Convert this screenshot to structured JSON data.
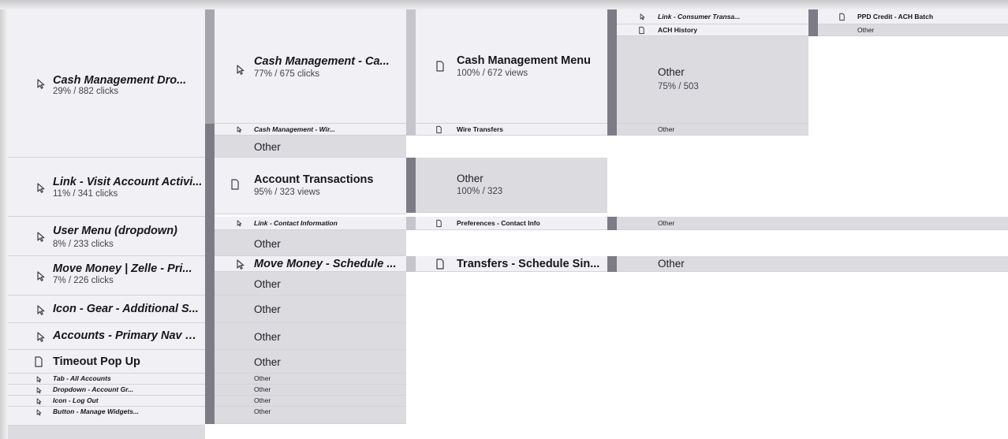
{
  "flow": {
    "level1": [
      {
        "title": "Cash Management Dro...",
        "stat": "29% / 882 clicks",
        "icon": "cursor-icon"
      },
      {
        "title": "Link - Visit Account Activi...",
        "stat": "11% / 341 clicks",
        "icon": "cursor-icon"
      },
      {
        "title": "User Menu (dropdown)",
        "stat": "8% / 233 clicks",
        "icon": "cursor-icon"
      },
      {
        "title": "Move Money | Zelle - Pri...",
        "stat": "7% / 226 clicks",
        "icon": "cursor-icon"
      },
      {
        "title": "Icon - Gear - Additional S...",
        "icon": "cursor-icon"
      },
      {
        "title": "Accounts - Primary Nav D...",
        "icon": "cursor-icon"
      },
      {
        "title": "Timeout Pop Up",
        "icon": "page-icon"
      },
      {
        "title": "Tab - All Accounts",
        "icon": "cursor-icon"
      },
      {
        "title": "Dropdown - Account Gr...",
        "icon": "cursor-icon"
      },
      {
        "title": "Icon - Log Out",
        "icon": "cursor-icon"
      },
      {
        "title": "Button - Manage Widgets...",
        "icon": "cursor-icon"
      }
    ],
    "level2": [
      {
        "title": "Cash Management - Ca...",
        "stat": "77% / 675 clicks",
        "icon": "cursor-icon"
      },
      {
        "title": "Cash Management - Wir...",
        "icon": "cursor-icon"
      },
      {
        "title": "Account Transactions",
        "stat": "95% / 323 views",
        "icon": "page-icon"
      },
      {
        "title": "Link - Contact Information",
        "icon": "cursor-icon"
      },
      {
        "title": "Move Money - Schedule ...",
        "icon": "cursor-icon"
      }
    ],
    "level3": [
      {
        "title": "Cash Management Menu",
        "stat": "100% / 672 views",
        "icon": "page-icon"
      },
      {
        "title": "Wire Transfers",
        "icon": "page-icon"
      },
      {
        "title": "Other",
        "stat": "100% / 323"
      },
      {
        "title": "Preferences - Contact Info",
        "icon": "page-icon"
      },
      {
        "title": "Transfers - Schedule Sin...",
        "icon": "page-icon"
      }
    ],
    "level4": [
      {
        "title": "Link - Consumer Transa...",
        "icon": "cursor-icon"
      },
      {
        "title": "ACH History",
        "icon": "page-icon"
      },
      {
        "title": "Other",
        "stat": "75% / 503"
      }
    ],
    "level5": [
      {
        "title": "PPD Credit - ACH Batch",
        "icon": "page-icon"
      }
    ],
    "other_label": "Other"
  }
}
